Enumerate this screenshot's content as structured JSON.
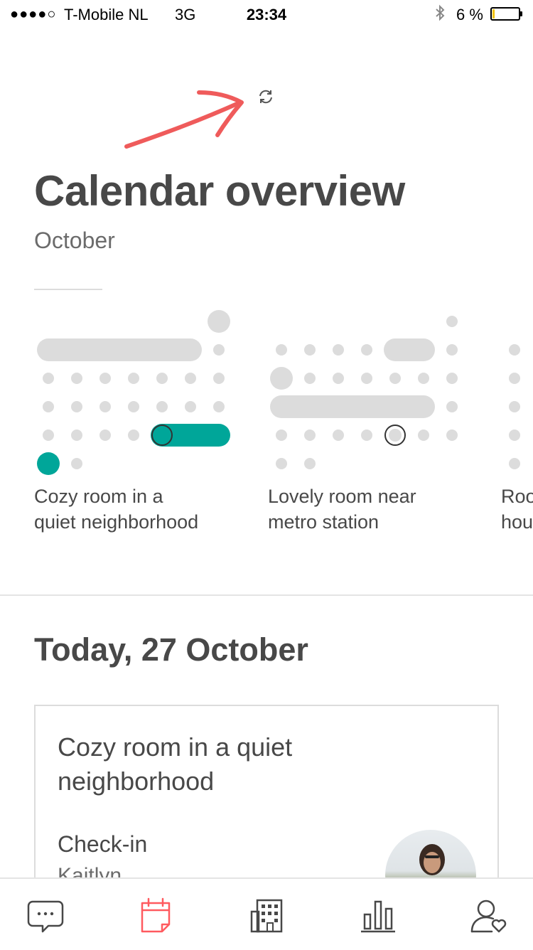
{
  "status_bar": {
    "signal": "●●●●○",
    "carrier": "T-Mobile NL",
    "network": "3G",
    "time": "23:34",
    "battery_text": "6 %",
    "battery_level": 0.06,
    "icons": [
      "bluetooth-icon",
      "battery-icon"
    ]
  },
  "annotation": {
    "icon": "red-arrow-annotation",
    "color": "#ef5b5b"
  },
  "header": {
    "refresh_icon": "refresh-icon",
    "title": "Calendar overview",
    "month": "October"
  },
  "listings": [
    {
      "line1": "Cozy room in a",
      "line2": "quiet neighborhood"
    },
    {
      "line1": "Lovely room near",
      "line2": "metro station"
    },
    {
      "line1": "Roo",
      "line2": "hou"
    }
  ],
  "today": {
    "heading": "Today, 27 October",
    "card": {
      "title": "Cozy room in a quiet neighborhood",
      "event": "Check-in",
      "guest": "Kaitlyn"
    }
  },
  "tab_bar": {
    "tabs": [
      {
        "name": "messages",
        "icon": "chat-bubble-icon",
        "active": false
      },
      {
        "name": "calendar",
        "icon": "calendar-icon",
        "active": true
      },
      {
        "name": "listings",
        "icon": "building-icon",
        "active": false
      },
      {
        "name": "stats",
        "icon": "bar-chart-icon",
        "active": false
      },
      {
        "name": "profile",
        "icon": "user-heart-icon",
        "active": false
      }
    ]
  },
  "colors": {
    "accent": "#ff5a5f",
    "booked": "#00a699",
    "dot": "#dcdcdc",
    "text": "#484848"
  }
}
